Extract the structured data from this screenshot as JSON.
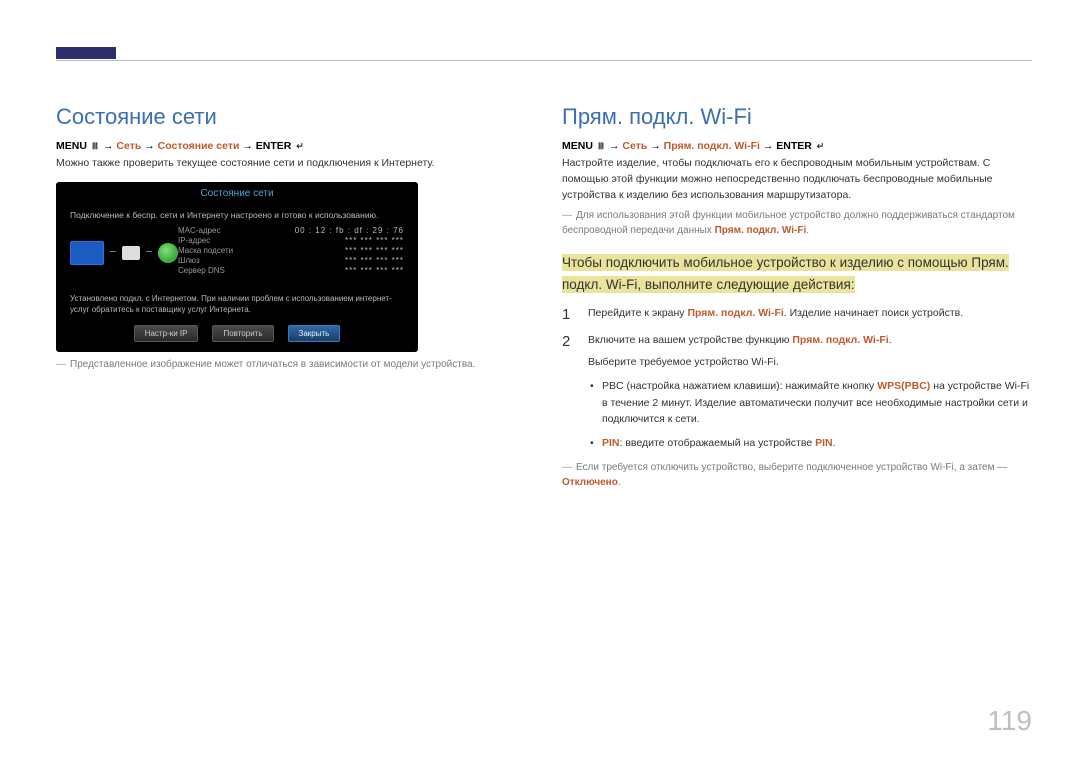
{
  "page_number": "119",
  "left": {
    "title": "Состояние сети",
    "path_prefix": "MENU",
    "path_mid1": "Сеть",
    "path_mid2": "Состояние сети",
    "path_suffix": "ENTER",
    "intro": "Можно также проверить текущее состояние сети и подключения к Интернету.",
    "disclaimer": "Представленное изображение может отличаться в зависимости от модели устройства.",
    "screenshot": {
      "title": "Состояние сети",
      "status_line": "Подключение к беспр. сети и Интернету настроено и готово к использованию.",
      "rows": [
        {
          "k": "MAC-адрес",
          "v": "00 : 12 : fb : df : 29 : 76"
        },
        {
          "k": "IP-адрес",
          "v": "***  ***  ***  ***"
        },
        {
          "k": "Маска подсети",
          "v": "***  ***  ***  ***"
        },
        {
          "k": "Шлюз",
          "v": "***  ***  ***  ***"
        },
        {
          "k": "Сервер DNS",
          "v": "***  ***  ***  ***"
        }
      ],
      "message": "Установлено подкл. с Интернетом. При наличии проблем с использованием интернет-услуг обратитесь к поставщику услуг Интернета.",
      "buttons": {
        "ip": "Настр-ки IP",
        "retry": "Повторить",
        "close": "Закрыть"
      }
    }
  },
  "right": {
    "title": "Прям. подкл. Wi-Fi",
    "path_prefix": "MENU",
    "path_mid1": "Сеть",
    "path_mid2": "Прям. подкл. Wi-Fi",
    "path_suffix": "ENTER",
    "para1": "Настройте изделие, чтобы подключать его к беспроводным мобильным устройствам. С помощью этой функции можно непосредственно подключать беспроводные мобильные устройства к изделию без использования маршрутизатора.",
    "note1_a": "Для использования этой функции мобильное устройство должно поддерживаться стандартом беспроводной передачи данных ",
    "note1_b": "Прям. подкл. Wi-Fi",
    "highlight": "Чтобы подключить мобильное устройство к изделию с помощью Прям. подкл. Wi-Fi, выполните следующие действия:",
    "steps": {
      "s1_a": "Перейдите к экрану ",
      "s1_b": "Прям. подкл. Wi-Fi",
      "s1_c": ". Изделие начинает поиск устройств.",
      "s2_a": "Включите на вашем устройстве функцию ",
      "s2_b": "Прям. подкл. Wi-Fi",
      "s2_c": ".",
      "s2_sub": "Выберите требуемое устройство Wi-Fi.",
      "b1_a": "PBC (настройка нажатием клавиши): нажимайте кнопку ",
      "b1_b": "WPS(PBC)",
      "b1_c": " на устройстве Wi-Fi в течение 2 минут. Изделие автоматически получит все необходимые настройки сети и подключится к сети.",
      "b2_a": "PIN",
      "b2_b": ": введите отображаемый на устройстве ",
      "b2_c": "PIN",
      "b2_d": "."
    },
    "note2_a": "Если требуется отключить устройство, выберите подключенное устройство Wi-Fi, а затем — ",
    "note2_b": "Отключено",
    "note2_c": "."
  }
}
